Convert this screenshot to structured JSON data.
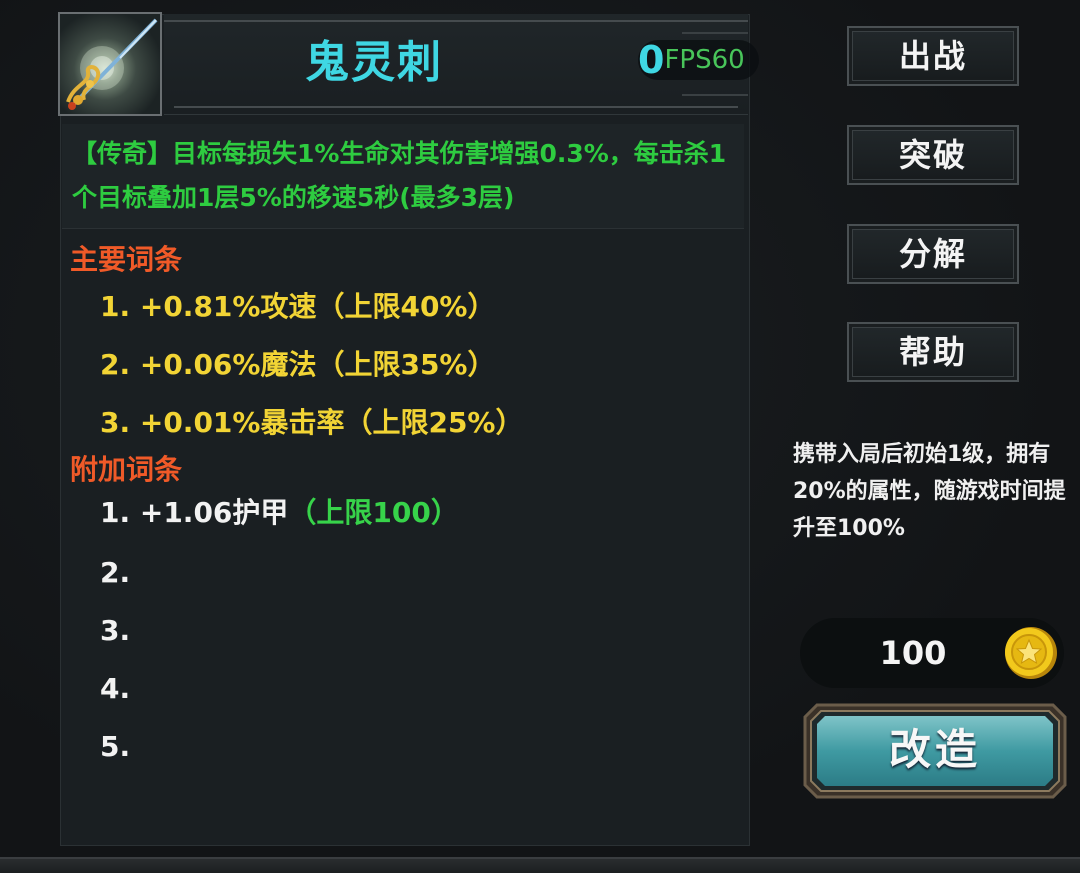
{
  "item": {
    "name": "鬼灵刺",
    "icon": "spear-weapon-icon",
    "description": "【传奇】目标每损失1%生命对其伤害增强0.3%，每击杀1个目标叠加1层5%的移速5秒(最多3层)"
  },
  "fps": {
    "value": "0",
    "label": "FPS60"
  },
  "main_affixes": {
    "title": "主要词条",
    "items": [
      {
        "text": "1. +0.81%攻速（上限40%）"
      },
      {
        "text": "2. +0.06%魔法（上限35%）"
      },
      {
        "text": "3. +0.01%暴击率（上限25%）"
      }
    ]
  },
  "extra_affixes": {
    "title": "附加词条",
    "items": [
      {
        "text": "1. +1.06护甲",
        "limit": "（上限100）"
      },
      {
        "text": "2."
      },
      {
        "text": "3."
      },
      {
        "text": "4."
      },
      {
        "text": "5."
      }
    ]
  },
  "actions": {
    "deploy": "出战",
    "breakthrough": "突破",
    "decompose": "分解",
    "help": "帮助"
  },
  "carry_note": "携带入局后初始1级，拥有20%的属性，随游戏时间提升至100%",
  "cost": {
    "value": "100",
    "icon": "gold-coin-icon"
  },
  "remake_button": "改造",
  "colors": {
    "name": "#3fd7e3",
    "description": "#2ecc40",
    "section_title": "#f05a28",
    "main_affix": "#f2d435",
    "limit": "#37d34a"
  }
}
